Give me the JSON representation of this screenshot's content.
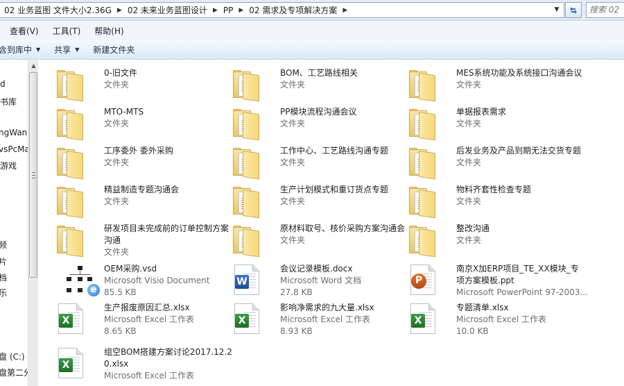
{
  "address": {
    "crumbs": [
      "02 业务蓝图 文件大小2.36G",
      "02 未来业务蓝图设计",
      "PP",
      "02 需求及专项解决方案"
    ]
  },
  "search": {
    "placeholder": "搜索 02"
  },
  "menu": [
    {
      "label": "查看(V)"
    },
    {
      "label": "工具(T)"
    },
    {
      "label": "帮助(H)"
    }
  ],
  "commands": [
    {
      "label": "含到库中",
      "has_caret": true
    },
    {
      "label": "共享",
      "has_caret": true
    },
    {
      "label": "新建文件夹",
      "has_caret": false
    }
  ],
  "nav": [
    {
      "label": "d"
    },
    {
      "label": "书库"
    },
    {
      "label": "ngWan"
    },
    {
      "label": "vsPcMa"
    },
    {
      "label": "游戏"
    },
    {
      "label": "频"
    },
    {
      "label": "片"
    },
    {
      "label": "档"
    },
    {
      "label": "乐"
    },
    {
      "label": "盘 (C:)"
    },
    {
      "label": "盘第二分"
    }
  ],
  "files": [
    {
      "name": "0-旧文件",
      "type": "文件夹",
      "size": "",
      "kind": "folder"
    },
    {
      "name": "BOM、工艺路线相关",
      "type": "文件夹",
      "size": "",
      "kind": "folder"
    },
    {
      "name": "MES系统功能及系统接口沟通会议",
      "type": "文件夹",
      "size": "",
      "kind": "folder"
    },
    {
      "name": "MTO-MTS",
      "type": "文件夹",
      "size": "",
      "kind": "folder"
    },
    {
      "name": "PP模块流程沟通会议",
      "type": "文件夹",
      "size": "",
      "kind": "folder"
    },
    {
      "name": "单据报表需求",
      "type": "文件夹",
      "size": "",
      "kind": "folder"
    },
    {
      "name": "工序委外 委外采购",
      "type": "文件夹",
      "size": "",
      "kind": "folder"
    },
    {
      "name": "工作中心、工艺路线沟通专题",
      "type": "文件夹",
      "size": "",
      "kind": "folder"
    },
    {
      "name": "后发业务及产品到期无法交货专题",
      "type": "文件夹",
      "size": "",
      "kind": "folder"
    },
    {
      "name": "精益制造专题沟通会",
      "type": "文件夹",
      "size": "",
      "kind": "folder"
    },
    {
      "name": "生产计划模式和重订货点专题",
      "type": "文件夹",
      "size": "",
      "kind": "folder-red"
    },
    {
      "name": "物料齐套性检查专题",
      "type": "文件夹",
      "size": "",
      "kind": "folder"
    },
    {
      "name": "研发项目未完成前的订单控制方案沟通",
      "type": "文件夹",
      "size": "",
      "kind": "folder"
    },
    {
      "name": "原材料取号、核价采购方案沟通会",
      "type": "文件夹",
      "size": "",
      "kind": "folder"
    },
    {
      "name": "整改沟通",
      "type": "文件夹",
      "size": "",
      "kind": "folder"
    },
    {
      "name": "OEM采购.vsd",
      "type": "Microsoft Visio Document",
      "size": "85.5 KB",
      "kind": "visio"
    },
    {
      "name": "会议记录模板.docx",
      "type": "Microsoft Word 文档",
      "size": "27.8 KB",
      "kind": "word"
    },
    {
      "name": "南京X加ERP项目_TE_XX模块_专项方案模板.ppt",
      "type": "Microsoft PowerPoint 97-2003...",
      "size": "",
      "kind": "ppt"
    },
    {
      "name": "生产报废原因汇总.xlsx",
      "type": "Microsoft Excel 工作表",
      "size": "8.65 KB",
      "kind": "excel"
    },
    {
      "name": "影响净需求的九大量.xlsx",
      "type": "Microsoft Excel 工作表",
      "size": "8.93 KB",
      "kind": "excel"
    },
    {
      "name": "专题清单.xlsx",
      "type": "Microsoft Excel 工作表",
      "size": "10.0 KB",
      "kind": "excel"
    },
    {
      "name": "组空BOM搭建方案讨论2017.12.20.xlsx",
      "type": "Microsoft Excel 工作表",
      "size": "",
      "kind": "excel"
    }
  ]
}
